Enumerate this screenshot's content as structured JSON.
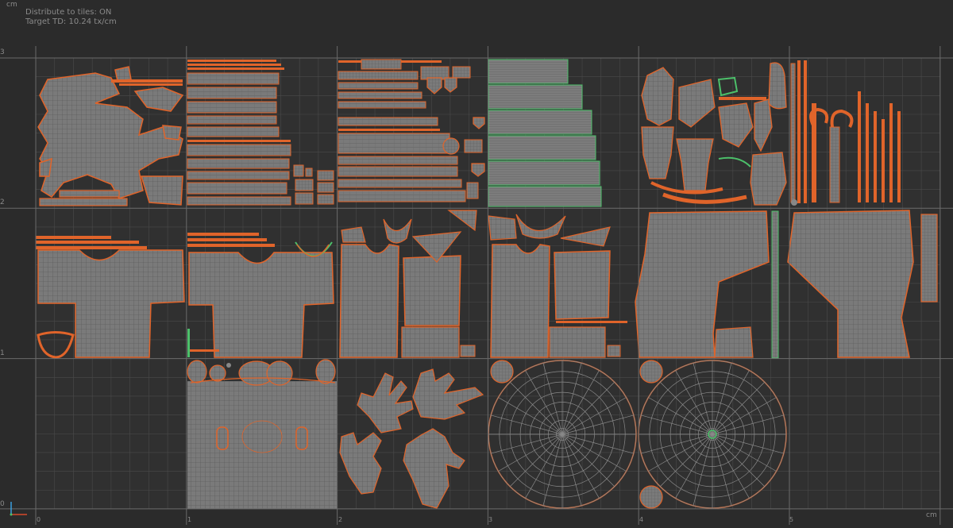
{
  "status": {
    "distribute_label": "Distribute to tiles: ON",
    "target_td_label": "Target TD: 10.24 tx/cm"
  },
  "axes": {
    "unit_top": "cm",
    "unit_bottom": "cm",
    "u_ticks": [
      "0",
      "1",
      "2",
      "3",
      "4",
      "5"
    ],
    "v_ticks": [
      "0",
      "1",
      "2",
      "3"
    ]
  },
  "colors": {
    "background": "#2b2b2b",
    "tile_fill": "#303030",
    "grid_line": "#4a4a4a",
    "tile_border": "#6a6a6a",
    "island_fill": "#787878",
    "island_wire": "#5c5c5c",
    "island_border": "#e0642a",
    "seam_green": "#4cc06a",
    "axis_u": "#d84a2a",
    "axis_v": "#3aa0e0"
  },
  "tiles": {
    "columns": 6,
    "rows": 3
  }
}
